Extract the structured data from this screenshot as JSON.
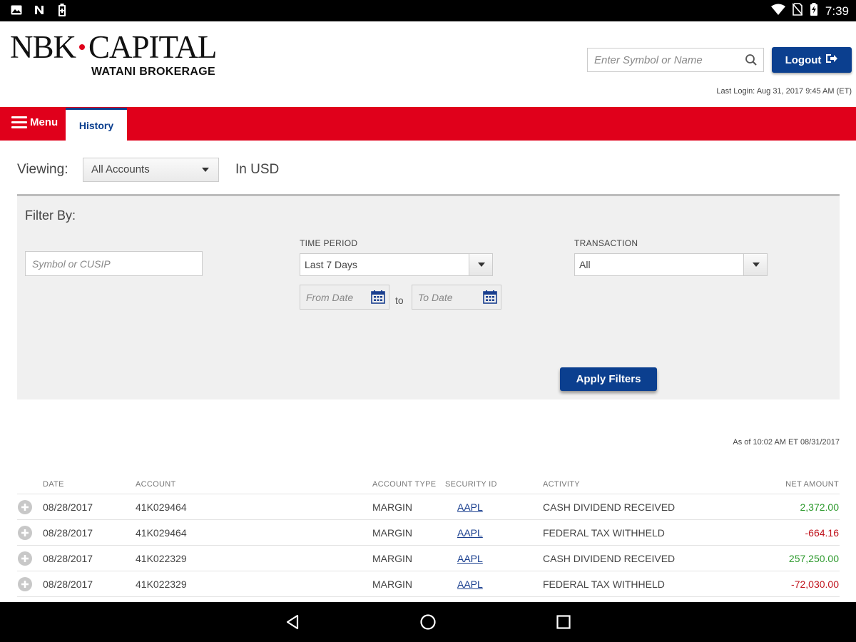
{
  "status_bar": {
    "time": "7:39",
    "left_icons": [
      "image-icon",
      "n-icon",
      "battery-saver-icon"
    ],
    "right_icons": [
      "wifi-icon",
      "no-sim-icon",
      "battery-charging-icon"
    ]
  },
  "header": {
    "logo_main_left": "NBK",
    "logo_main_right": "CAPITAL",
    "logo_sub": "WATANI BROKERAGE",
    "search_placeholder": "Enter Symbol or Name",
    "logout_label": "Logout",
    "last_login": "Last Login: Aug 31, 2017 9:45 AM (ET)"
  },
  "nav": {
    "menu_label": "Menu",
    "active_tab": "History"
  },
  "viewing": {
    "label": "Viewing:",
    "account_value": "All Accounts",
    "currency": "In USD"
  },
  "filter": {
    "title": "Filter By:",
    "symbol_placeholder": "Symbol or CUSIP",
    "time_period_label": "TIME PERIOD",
    "time_period_value": "Last 7 Days",
    "from_placeholder": "From Date",
    "to_label": "to",
    "to_placeholder": "To Date",
    "transaction_label": "TRANSACTION",
    "transaction_value": "All",
    "apply_label": "Apply Filters"
  },
  "as_of": "As of 10:02 AM ET 08/31/2017",
  "table": {
    "headers": {
      "date": "DATE",
      "account": "ACCOUNT",
      "account_type": "ACCOUNT TYPE",
      "security_id": "SECURITY ID",
      "activity": "ACTIVITY",
      "net_amount": "NET AMOUNT"
    },
    "rows": [
      {
        "date": "08/28/2017",
        "account": "41K029464",
        "account_type": "MARGIN",
        "security_id": "AAPL",
        "activity": "CASH DIVIDEND RECEIVED",
        "net_amount": "2,372.00",
        "sign": "positive"
      },
      {
        "date": "08/28/2017",
        "account": "41K029464",
        "account_type": "MARGIN",
        "security_id": "AAPL",
        "activity": "FEDERAL TAX WITHHELD",
        "net_amount": "-664.16",
        "sign": "negative"
      },
      {
        "date": "08/28/2017",
        "account": "41K022329",
        "account_type": "MARGIN",
        "security_id": "AAPL",
        "activity": "CASH DIVIDEND RECEIVED",
        "net_amount": "257,250.00",
        "sign": "positive"
      },
      {
        "date": "08/28/2017",
        "account": "41K022329",
        "account_type": "MARGIN",
        "security_id": "AAPL",
        "activity": "FEDERAL TAX WITHHELD",
        "net_amount": "-72,030.00",
        "sign": "negative"
      }
    ]
  },
  "colors": {
    "brand_red": "#e0001b",
    "brand_blue": "#0b3f8f",
    "positive": "#2e9a2e",
    "negative": "#c0141d"
  }
}
